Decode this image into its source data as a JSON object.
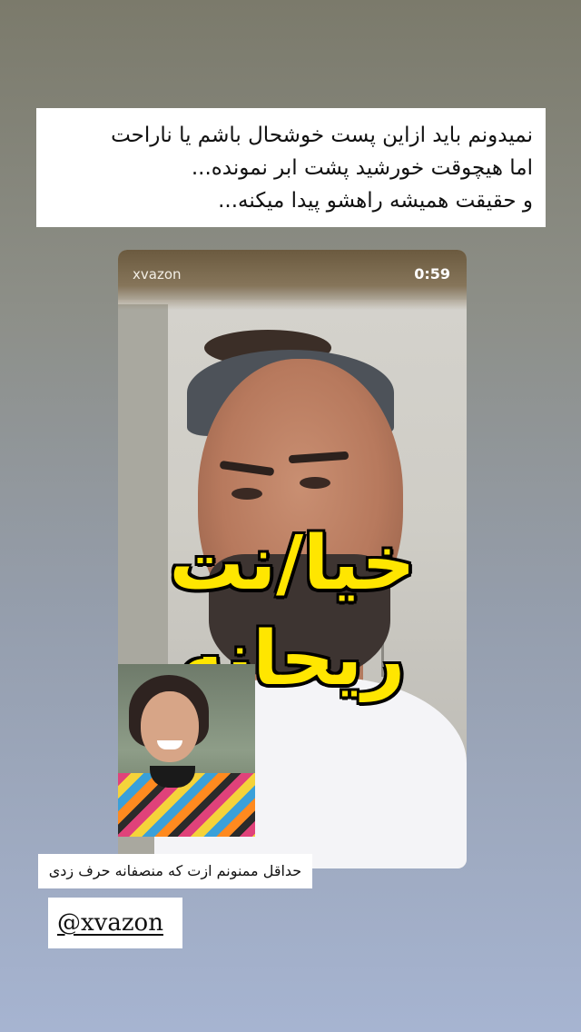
{
  "caption": {
    "lines": [
      "نمیدونم باید ازاین پست خوشحال باشم یا ناراحت",
      "اما هیچوقت خورشید پشت ابر نمونده...",
      "و حقیقت همیشه راهشو پیدا میکنه..."
    ]
  },
  "video": {
    "username": "xvazon",
    "time": "0:59",
    "overlay_line1": "خیا/نت",
    "overlay_line2": "ریحانه"
  },
  "note": "حداقل ممنونم ازت که منصفانه حرف زدی",
  "mention": "@xvazon",
  "colors": {
    "overlay_text": "#ffe600",
    "background_top": "#7b7a6b",
    "background_bottom": "#a6b4d1"
  }
}
